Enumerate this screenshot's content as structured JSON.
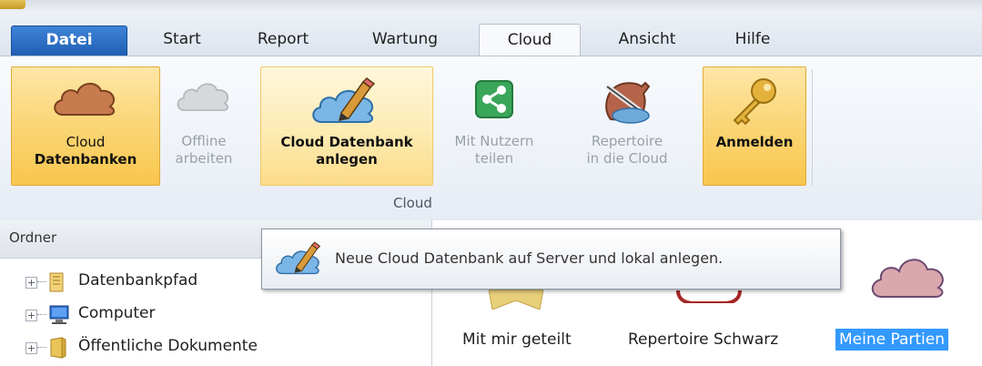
{
  "tabs": [
    {
      "label": "Datei"
    },
    {
      "label": "Start"
    },
    {
      "label": "Report"
    },
    {
      "label": "Wartung"
    },
    {
      "label": "Cloud",
      "active": true
    },
    {
      "label": "Ansicht"
    },
    {
      "label": "Hilfe"
    }
  ],
  "ribbon": {
    "buttons": [
      {
        "line1": "Cloud",
        "line2": "Datenbanken",
        "icon": "cloud-icon",
        "state": "pressed"
      },
      {
        "line1": "Offline",
        "line2": "arbeiten",
        "icon": "cloud-gray-icon",
        "state": "disabled"
      },
      {
        "line1": "Cloud Datenbank",
        "line2": "anlegen",
        "icon": "cloud-pencil-icon",
        "state": "hover"
      },
      {
        "line1": "Mit Nutzern",
        "line2": "teilen",
        "icon": "share-icon",
        "state": "disabled"
      },
      {
        "line1": "Repertoire",
        "line2": "in die Cloud",
        "icon": "knight-icon",
        "state": "disabled"
      },
      {
        "line1": "Anmelden",
        "line2": "",
        "icon": "key-icon",
        "state": "pressed"
      }
    ],
    "group_label": "Cloud"
  },
  "folder_pane": {
    "header": "Ordner",
    "items": [
      {
        "label": "Datenbankpfad",
        "icon": "database-folder-icon"
      },
      {
        "label": "Computer",
        "icon": "computer-icon"
      },
      {
        "label": "Öffentliche Dokumente",
        "icon": "folder-icon"
      }
    ]
  },
  "content": {
    "items": [
      {
        "label": "Mit mir geteilt"
      },
      {
        "label": "Repertoire Schwarz"
      },
      {
        "label": "Meine Partien",
        "selected": true
      }
    ]
  },
  "tooltip": {
    "text": "Neue Cloud Datenbank auf Server und lokal anlegen."
  },
  "colors": {
    "ribbon_highlight": "#f8c64c",
    "selection": "#3399ff",
    "file_tab": "#2a6dc4"
  }
}
